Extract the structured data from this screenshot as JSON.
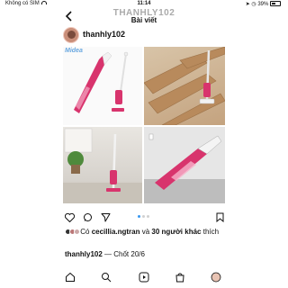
{
  "status_bar": {
    "carrier": "Không có SIM",
    "time": "11:14",
    "battery": "39%"
  },
  "header": {
    "username_title": "THANHLY102",
    "title": "Bài viết"
  },
  "post": {
    "username": "thanhly102",
    "brand": "Midea",
    "likes_prefix": "Có",
    "liked_by": "cecillia.ngtran",
    "likes_middle": "và",
    "others": "30 người khác",
    "likes_suffix": "thích",
    "caption_user": "thanhly102",
    "caption_text": "— Chốt 20/6"
  },
  "colors": {
    "vacuum_pink": "#d8346d",
    "dot_active": "#3897f0"
  },
  "icons": [
    "back-icon",
    "heart-icon",
    "comment-icon",
    "share-icon",
    "bookmark-icon",
    "home-icon",
    "search-icon",
    "reels-icon",
    "shop-icon",
    "profile-icon"
  ]
}
